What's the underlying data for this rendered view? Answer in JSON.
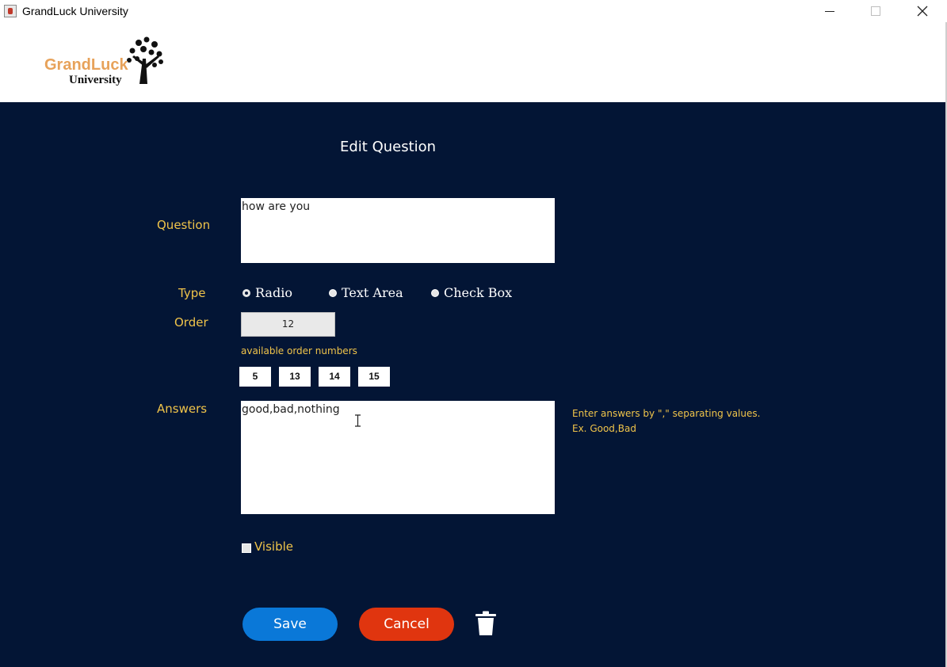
{
  "window": {
    "title": "GrandLuck University"
  },
  "logo": {
    "line1": "GrandLuck",
    "line2": "University"
  },
  "page": {
    "heading": "Edit Question"
  },
  "form": {
    "question_label": "Question",
    "question_value": "how are you",
    "type_label": "Type",
    "type_options": [
      "Radio",
      "Text Area",
      "Check Box"
    ],
    "type_selected": "Radio",
    "order_label": "Order",
    "order_value": "12",
    "available_label": "available order numbers",
    "available_numbers": [
      "5",
      "13",
      "14",
      "15"
    ],
    "answers_label": "Answers",
    "answers_value": "good,bad,nothing",
    "answers_hint_line1": "Enter answers by \",\" separating values.",
    "answers_hint_line2": "Ex.  Good,Bad",
    "visible_label": "Visible",
    "visible_checked": false
  },
  "actions": {
    "save": "Save",
    "cancel": "Cancel",
    "delete_icon": "trash-icon"
  },
  "colors": {
    "background": "#031535",
    "label": "#f0c44a",
    "save": "#0a78d8",
    "cancel": "#e0350f"
  }
}
